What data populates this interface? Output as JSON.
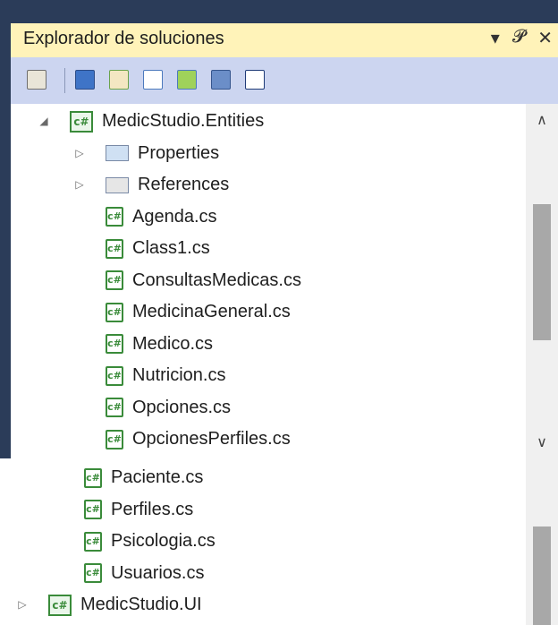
{
  "panel": {
    "title": "Explorador de soluciones",
    "title_buttons": {
      "dropdown": "▾",
      "pin": "ᵖ",
      "close": "✕"
    }
  },
  "toolbar": {
    "icons": [
      "properties-icon",
      "show-all-files-icon",
      "refresh-icon",
      "view-code-icon",
      "view-designer-icon",
      "class-diagram-icon",
      "nested-related-files-icon"
    ]
  },
  "tree_top": [
    {
      "label": "MedicStudio.Entities",
      "kind": "project",
      "expander": "◢",
      "level": 0
    },
    {
      "label": "Properties",
      "kind": "folder",
      "expander": "▷",
      "level": 1
    },
    {
      "label": "References",
      "kind": "references",
      "expander": "▷",
      "level": 1
    },
    {
      "label": "Agenda.cs",
      "kind": "cs",
      "level": 1
    },
    {
      "label": "Class1.cs",
      "kind": "cs",
      "level": 1
    },
    {
      "label": "ConsultasMedicas.cs",
      "kind": "cs",
      "level": 1
    },
    {
      "label": "MedicinaGeneral.cs",
      "kind": "cs",
      "level": 1
    },
    {
      "label": "Medico.cs",
      "kind": "cs",
      "level": 1
    },
    {
      "label": "Nutricion.cs",
      "kind": "cs",
      "level": 1
    },
    {
      "label": "Opciones.cs",
      "kind": "cs",
      "level": 1
    },
    {
      "label": "OpcionesPerfiles.cs",
      "kind": "cs",
      "level": 1
    }
  ],
  "tree_bottom": [
    {
      "label": "Paciente.cs",
      "kind": "cs"
    },
    {
      "label": "Perfiles.cs",
      "kind": "cs"
    },
    {
      "label": "Psicologia.cs",
      "kind": "cs"
    },
    {
      "label": "Usuarios.cs",
      "kind": "cs"
    },
    {
      "label": "MedicStudio.UI",
      "kind": "project",
      "expander": "▷"
    }
  ],
  "cs_glyph": "c#",
  "colors": {
    "title_bg": "#fff3b9",
    "toolbar_bg": "#ccd5f0",
    "frame": "#2b3c59",
    "cs_green": "#3a8b3a"
  }
}
